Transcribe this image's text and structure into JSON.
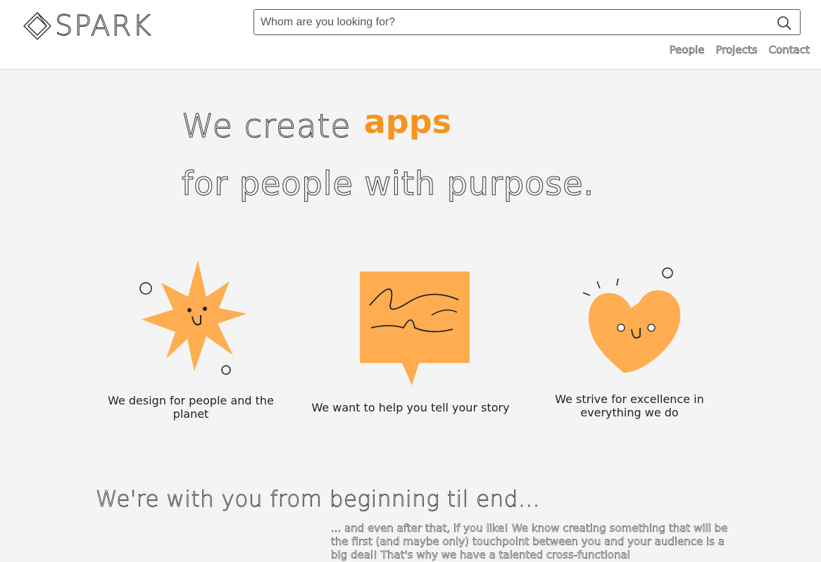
{
  "header": {
    "logo_text": "SPARK",
    "search": {
      "placeholder": "Whom are you looking for?",
      "value": ""
    },
    "nav": [
      "People",
      "Projects",
      "Contact"
    ]
  },
  "hero": {
    "line1_prefix": "We create",
    "accent_word": "apps",
    "line2": "for people with purpose."
  },
  "features": [
    {
      "icon": "star-face-icon",
      "caption": "We design for people and the planet"
    },
    {
      "icon": "speech-bubble-icon",
      "caption": "We want to help you tell your story"
    },
    {
      "icon": "heart-face-icon",
      "caption": "We strive for excellence in everything we do"
    }
  ],
  "section": {
    "title": "We're with you from beginning til end...",
    "body": "... and even after that, if you like! We know creating something that will be the first (and maybe only) touchpoint between you and your audience is a big deal! That's why we have a talented cross-functional"
  },
  "colors": {
    "accent": "#f7931e",
    "illustration": "#ffad50",
    "background": "#f4f4f4"
  }
}
